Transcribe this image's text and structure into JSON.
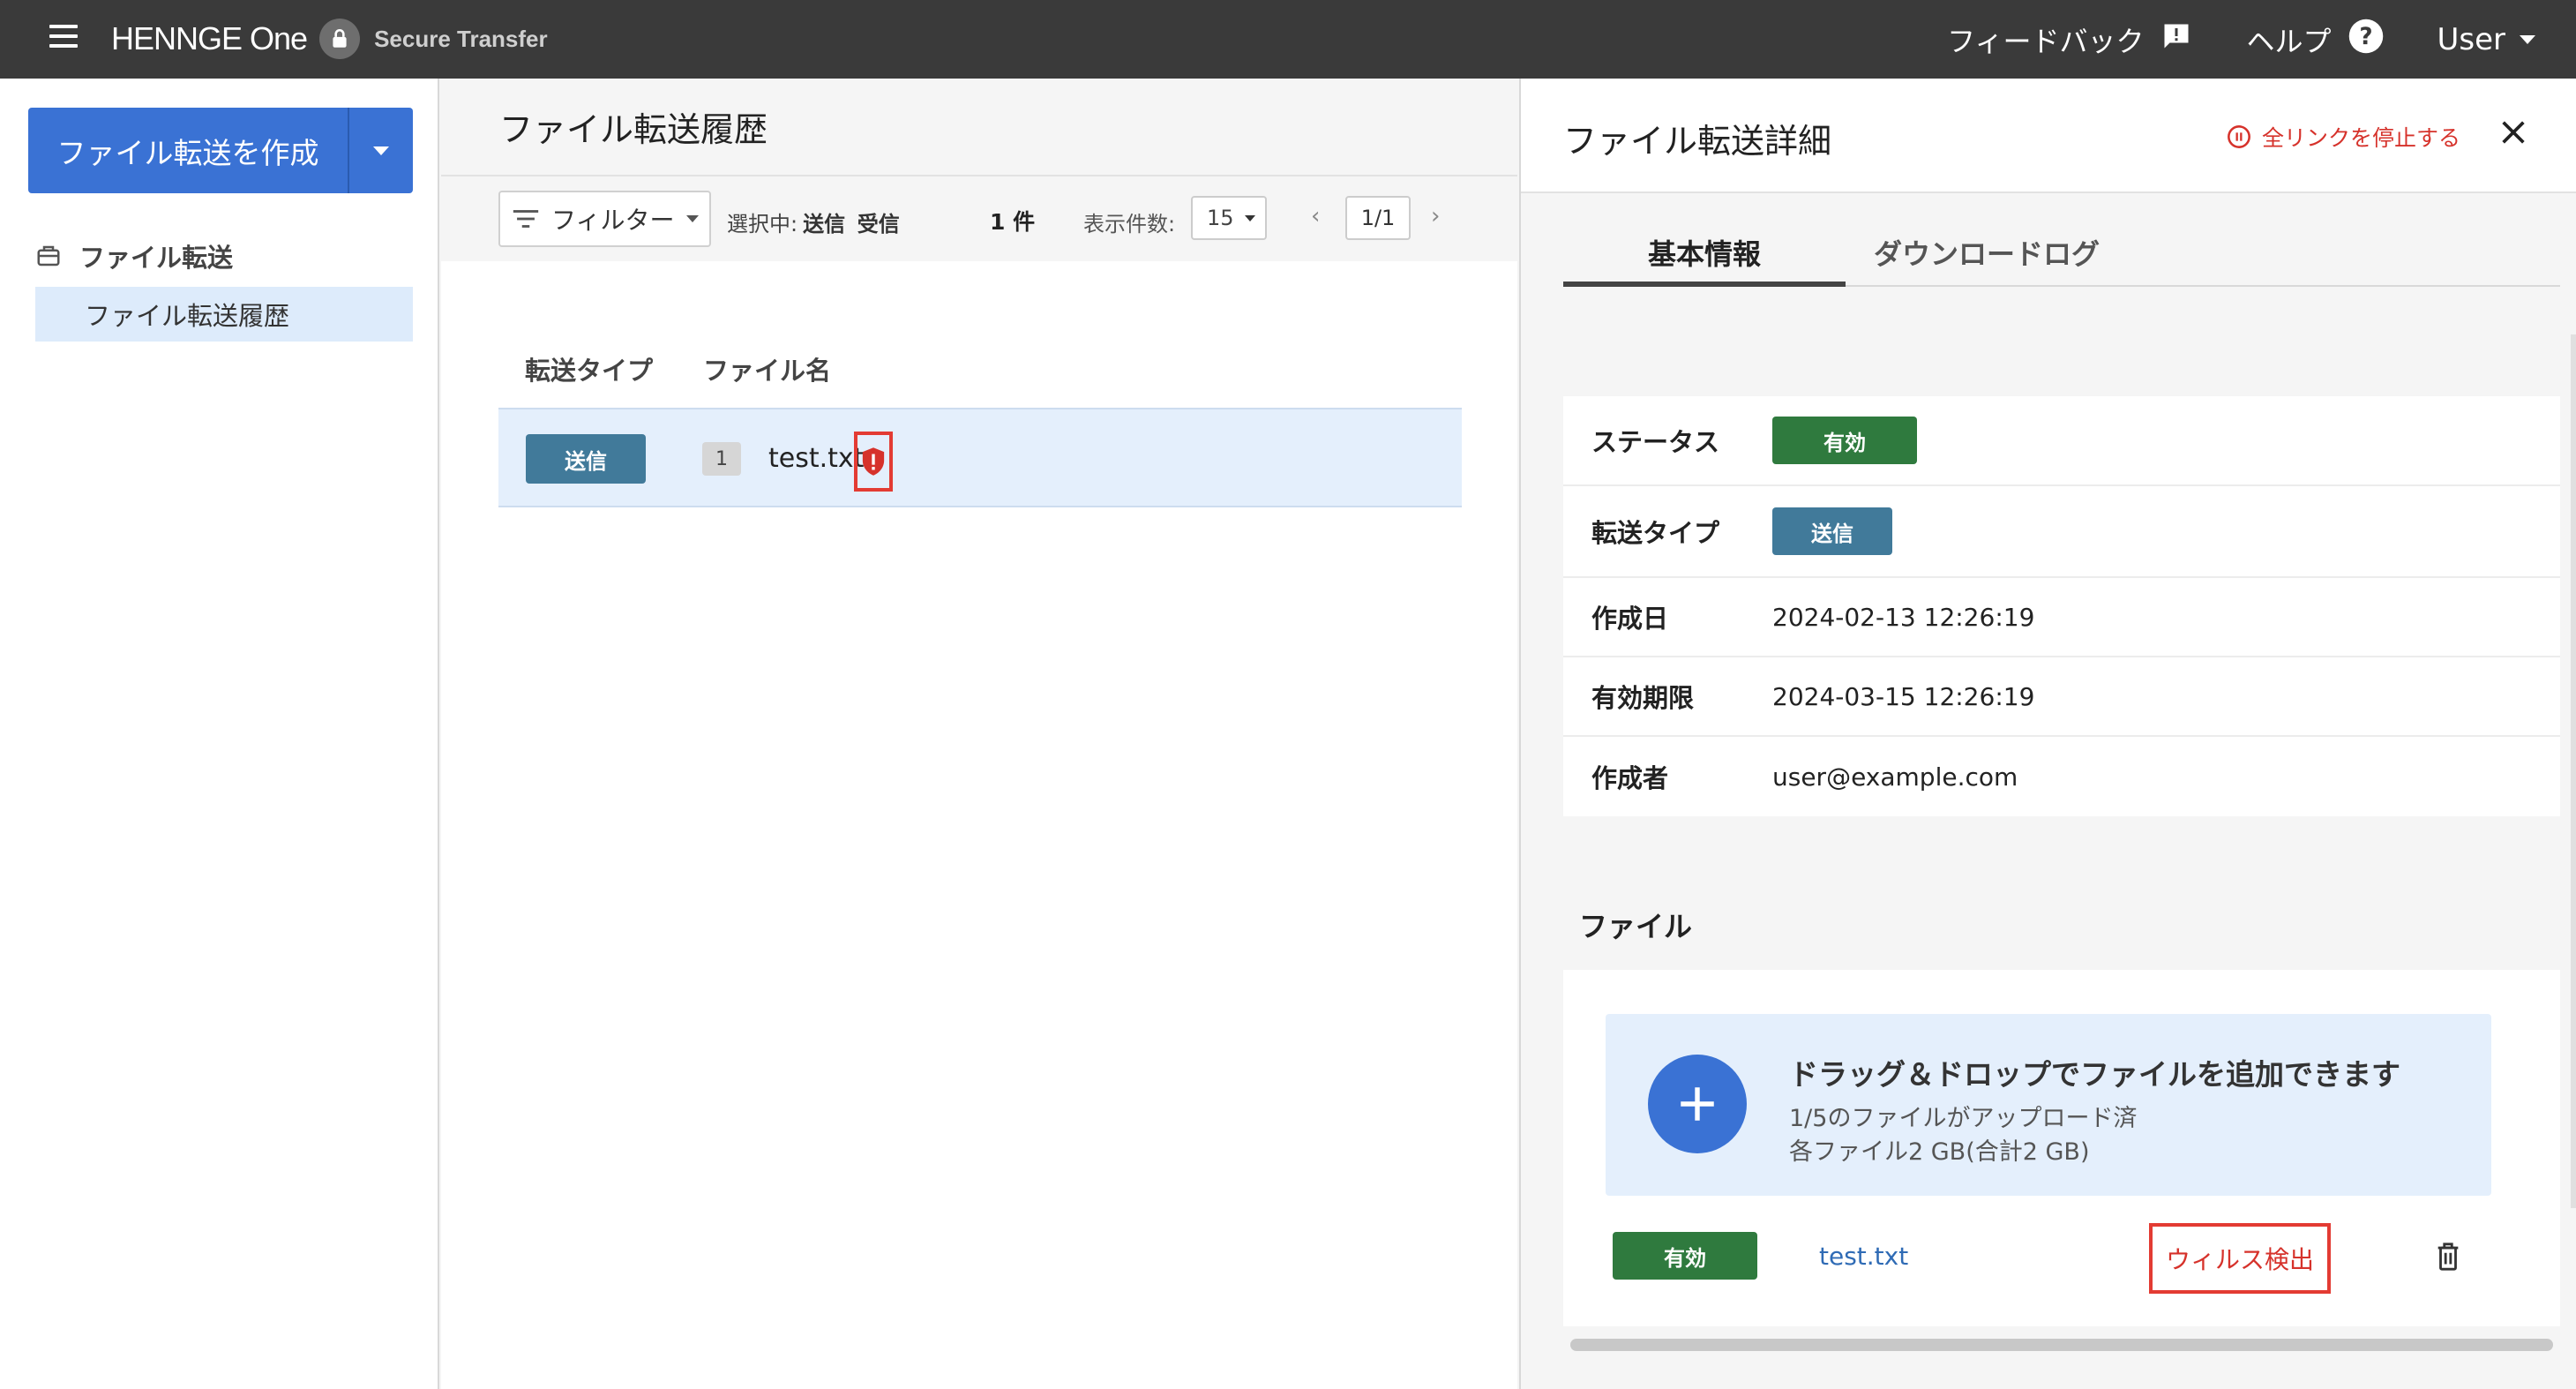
{
  "header": {
    "brand": "HENNGE One",
    "product": "Secure Transfer",
    "feedback": "フィードバック",
    "help": "ヘルプ",
    "user": "User"
  },
  "sidebar": {
    "create_button": "ファイル転送を作成",
    "group_label": "ファイル転送",
    "items": [
      {
        "label": "ファイル転送履歴"
      }
    ]
  },
  "list": {
    "title": "ファイル転送履歴",
    "filter_label": "フィルター",
    "selected_prefix": "選択中:",
    "selected_send": "送信",
    "selected_receive": "受信",
    "count": "1 件",
    "per_page_label": "表示件数:",
    "per_page": "15",
    "page": "1/1",
    "columns": [
      "転送タイプ",
      "ファイル名"
    ],
    "rows": [
      {
        "type": "送信",
        "file_count": "1",
        "file_name": "test.txt"
      }
    ]
  },
  "detail": {
    "title": "ファイル転送詳細",
    "stop_all_links": "全リンクを停止する",
    "tabs": [
      "基本情報",
      "ダウンロードログ"
    ],
    "fields": {
      "status_label": "ステータス",
      "status_value": "有効",
      "type_label": "転送タイプ",
      "type_value": "送信",
      "created_label": "作成日",
      "created_value": "2024-02-13 12:26:19",
      "expires_label": "有効期限",
      "expires_value": "2024-03-15 12:26:19",
      "creator_label": "作成者",
      "creator_value": "user@example.com"
    },
    "files_title": "ファイル",
    "dropzone": {
      "title": "ドラッグ＆ドロップでファイルを追加できます",
      "uploaded": "1/5のファイルがアップロード済",
      "limit": "各ファイル2 GB(合計2 GB)"
    },
    "file": {
      "status": "有効",
      "name": "test.txt",
      "virus_label": "ウィルス検出"
    }
  },
  "colors": {
    "topbar": "#3a3a3a",
    "primary": "#3a72d4",
    "status_green": "#2f7a3e",
    "type_blue": "#417a9a",
    "alert_red": "#e33b33"
  }
}
